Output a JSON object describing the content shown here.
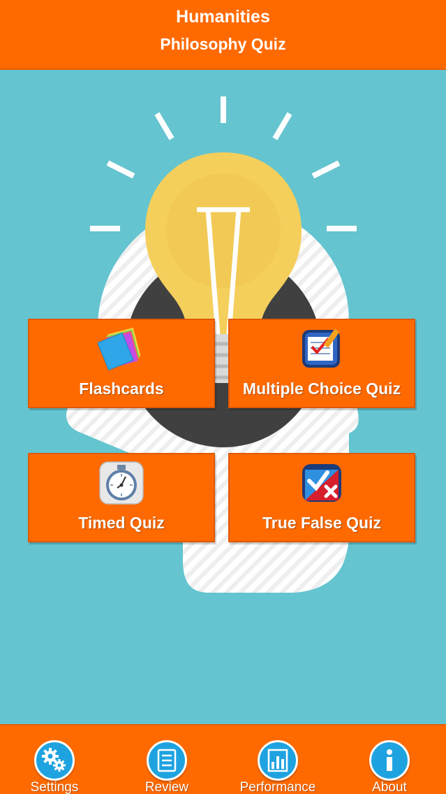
{
  "header": {
    "category": "Humanities",
    "title": "Philosophy Quiz"
  },
  "menu": {
    "flashcards": {
      "label": "Flashcards",
      "icon": "flashcards-icon"
    },
    "multiple_choice": {
      "label": "Multiple Choice Quiz",
      "icon": "checklist-icon"
    },
    "timed": {
      "label": "Timed Quiz",
      "icon": "stopwatch-icon"
    },
    "true_false": {
      "label": "True False Quiz",
      "icon": "check-cross-icon"
    }
  },
  "tabbar": [
    {
      "label": "Settings",
      "icon": "gears-icon"
    },
    {
      "label": "Review",
      "icon": "list-icon"
    },
    {
      "label": "Performance",
      "icon": "bar-chart-icon"
    },
    {
      "label": "About",
      "icon": "info-icon"
    }
  ],
  "colors": {
    "accent": "#ff6a00",
    "background": "#64c4cf",
    "tab_icon": "#1fa3e0",
    "bulb": "#f5cf5c"
  }
}
